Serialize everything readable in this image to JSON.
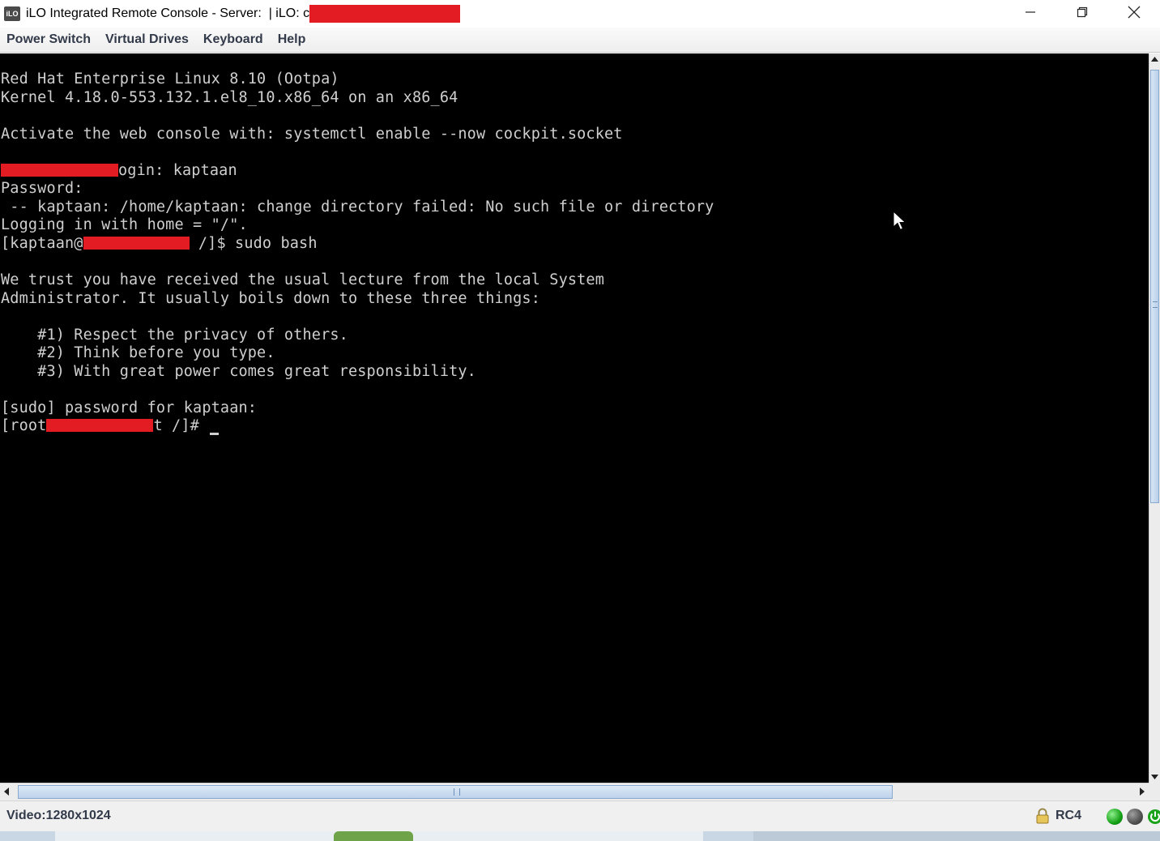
{
  "window": {
    "app_icon_text": "iLO",
    "title": "iLO Integrated Remote Console - Server:  | iLO: c",
    "controls": [
      "minimize",
      "restore",
      "close"
    ]
  },
  "menu": {
    "items": [
      "Power Switch",
      "Virtual Drives",
      "Keyboard",
      "Help"
    ]
  },
  "console": {
    "line_os": "Red Hat Enterprise Linux 8.10 (Ootpa)",
    "line_kernel": "Kernel 4.18.0-553.132.1.el8_10.x86_64 on an x86_64",
    "line_cockpit": "Activate the web console with: systemctl enable --now cockpit.socket",
    "login_suffix": "ogin: kaptaan",
    "line_password": "Password:",
    "line_cd_failed": " -- kaptaan: /home/kaptaan: change directory failed: No such file or directory",
    "line_logging": "Logging in with home = \"/\".",
    "prompt_user_prefix": "[kaptaan@",
    "prompt_user_suffix": " /]$ sudo bash",
    "lecture_1": "We trust you have received the usual lecture from the local System",
    "lecture_2": "Administrator. It usually boils down to these three things:",
    "rule_1": "    #1) Respect the privacy of others.",
    "rule_2": "    #2) Think before you type.",
    "rule_3": "    #3) With great power comes great responsibility.",
    "sudo_prompt": "[sudo] password for kaptaan:",
    "root_prefix": "[root",
    "root_suffix": "t /]# ",
    "redaction_color": "#e31c23",
    "text_color": "#cfcfcf",
    "background": "#000000"
  },
  "statusbar": {
    "video": "Video:1280x1024",
    "encryption": "RC4",
    "lock_icon": "lock-icon",
    "indicators": [
      "green-led",
      "gray-led",
      "power-icon"
    ]
  }
}
